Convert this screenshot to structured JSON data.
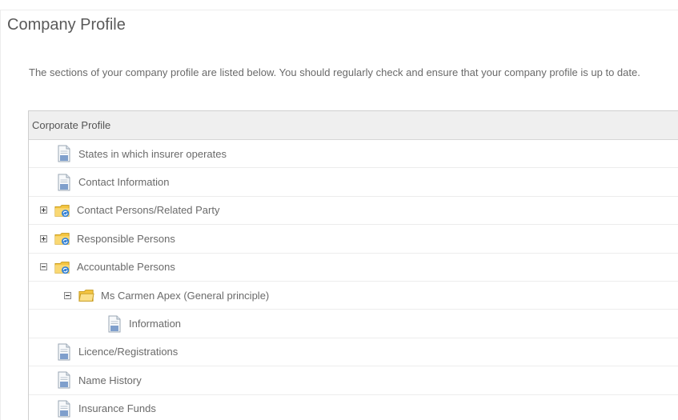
{
  "page": {
    "title": "Company Profile",
    "intro": "The sections of your company profile are listed below. You should regularly check and ensure that your company profile is up to date."
  },
  "tree": {
    "header": "Corporate Profile",
    "items": [
      {
        "label": "States in which insurer operates",
        "icon": "document-icon",
        "toggle": "none",
        "level": 0
      },
      {
        "label": "Contact Information",
        "icon": "document-icon",
        "toggle": "none",
        "level": 0
      },
      {
        "label": "Contact Persons/Related Party",
        "icon": "folder-sync-icon",
        "toggle": "expand",
        "level": 0
      },
      {
        "label": "Responsible Persons",
        "icon": "folder-sync-icon",
        "toggle": "expand",
        "level": 0
      },
      {
        "label": "Accountable Persons",
        "icon": "folder-sync-icon",
        "toggle": "collapse",
        "level": 0
      },
      {
        "label": "Ms Carmen Apex (General principle)",
        "icon": "folder-icon",
        "toggle": "collapse",
        "level": 1
      },
      {
        "label": "Information",
        "icon": "document-icon",
        "toggle": "none",
        "level": 2
      },
      {
        "label": "Licence/Registrations",
        "icon": "document-icon",
        "toggle": "none",
        "level": 0
      },
      {
        "label": "Name History",
        "icon": "document-icon",
        "toggle": "none",
        "level": 0
      },
      {
        "label": "Insurance Funds",
        "icon": "document-icon",
        "toggle": "none",
        "level": 0
      }
    ]
  },
  "colors": {
    "text": "#6a6a6a",
    "header_bg": "#efefef",
    "folder_yellow": "#f4c542",
    "sync_blue": "#2f7fd6"
  }
}
